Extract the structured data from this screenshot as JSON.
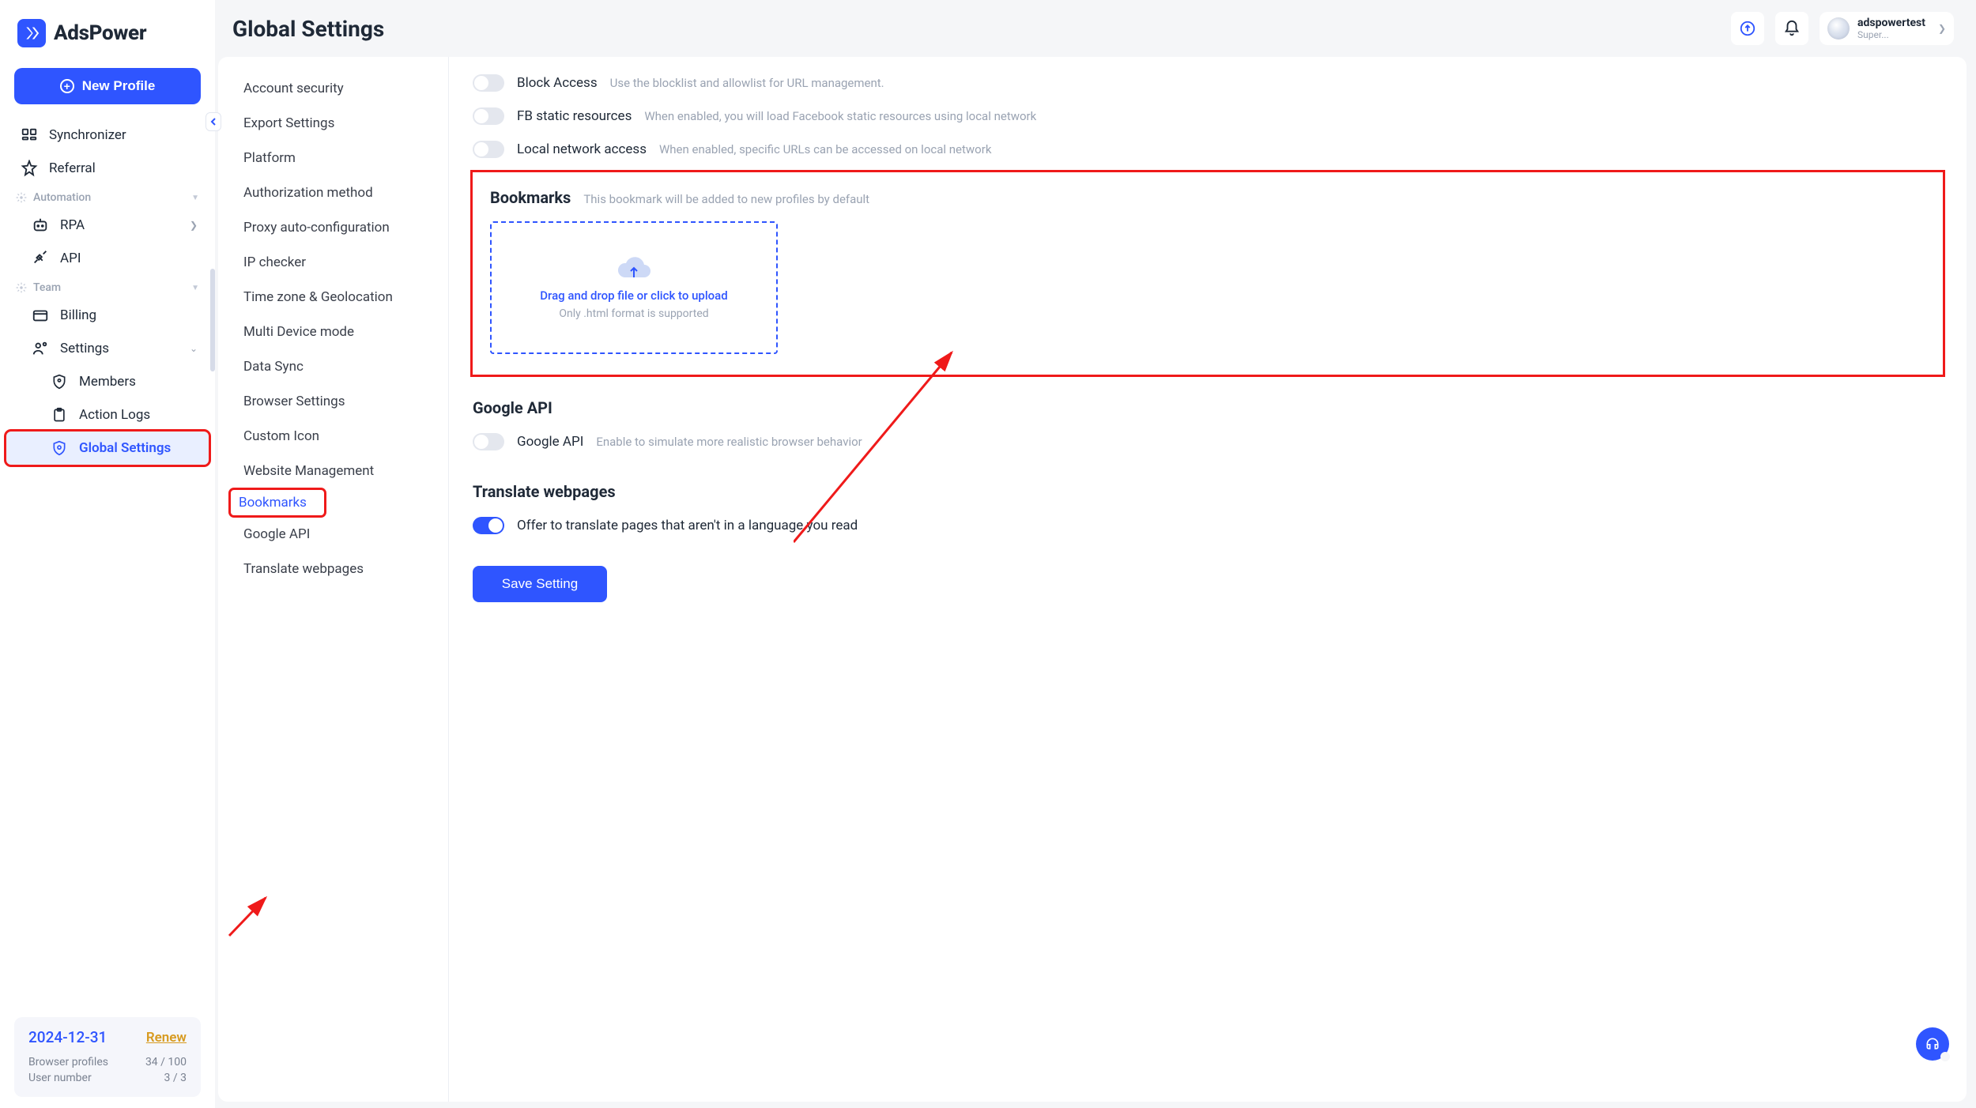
{
  "brand": "AdsPower",
  "new_profile_label": "New Profile",
  "page_title": "Global Settings",
  "sidebar": {
    "items_top": [
      {
        "label": "Synchronizer"
      },
      {
        "label": "Referral"
      }
    ],
    "section_automation": "Automation",
    "items_automation": [
      {
        "label": "RPA"
      },
      {
        "label": "API"
      }
    ],
    "section_team": "Team",
    "items_team": [
      {
        "label": "Billing"
      },
      {
        "label": "Settings"
      }
    ],
    "items_settings_sub": [
      {
        "label": "Members"
      },
      {
        "label": "Action Logs"
      },
      {
        "label": "Global Settings"
      }
    ]
  },
  "account": {
    "date": "2024-12-31",
    "renew": "Renew",
    "profiles_label": "Browser profiles",
    "profiles_value": "34 / 100",
    "users_label": "User number",
    "users_value": "3 / 3"
  },
  "user": {
    "name": "adspowertest",
    "role": "Super..."
  },
  "settings_nav": [
    "Account security",
    "Export Settings",
    "Platform",
    "Authorization method",
    "Proxy auto-configuration",
    "IP checker",
    "Time zone & Geolocation",
    "Multi Device mode",
    "Data Sync",
    "Browser Settings",
    "Custom Icon",
    "Website Management",
    "Bookmarks",
    "Google API",
    "Translate webpages"
  ],
  "toggles": {
    "block_access": {
      "label": "Block Access",
      "hint": "Use the blocklist and allowlist for URL management."
    },
    "fb_static": {
      "label": "FB static resources",
      "hint": "When enabled, you will load Facebook static resources using local network"
    },
    "local_net": {
      "label": "Local network access",
      "hint": "When enabled, specific URLs can be accessed on local network"
    },
    "google_api": {
      "label": "Google API",
      "hint": "Enable to simulate more realistic browser behavior"
    },
    "translate": {
      "label": "Offer to translate pages that aren't in a language you read"
    }
  },
  "sections": {
    "bookmarks_title": "Bookmarks",
    "bookmarks_hint": "This bookmark will be added to new profiles by default",
    "google_api_title": "Google API",
    "translate_title": "Translate webpages"
  },
  "dropzone": {
    "main": "Drag and drop file or click to upload",
    "sub": "Only .html format is supported"
  },
  "save_label": "Save Setting"
}
